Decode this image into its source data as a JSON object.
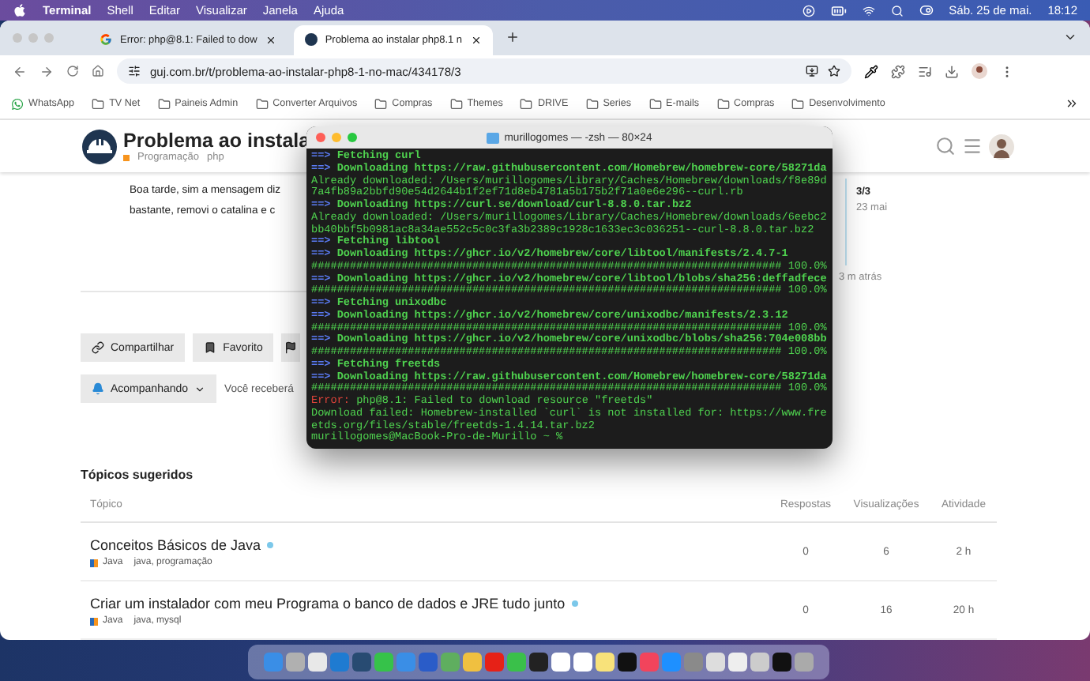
{
  "menu_bar": {
    "app": "Terminal",
    "menus": [
      "Shell",
      "Editar",
      "Visualizar",
      "Janela",
      "Ajuda"
    ],
    "date": "Sáb. 25 de mai.",
    "time": "18:12"
  },
  "browser": {
    "tabs": [
      {
        "title": "Error: php@8.1: Failed to dow",
        "kind": "google",
        "selected": false
      },
      {
        "title": "Problema ao instalar php8.1 n",
        "kind": "site",
        "selected": true
      }
    ],
    "address": "guj.com.br/t/problema-ao-instalar-php8-1-no-mac/434178/3",
    "bookmarks": [
      {
        "kind": "whatsapp",
        "label": "WhatsApp"
      },
      {
        "kind": "folder",
        "label": "TV Net"
      },
      {
        "kind": "folder",
        "label": "Paineis Admin"
      },
      {
        "kind": "folder",
        "label": "Converter Arquivos"
      },
      {
        "kind": "folder",
        "label": "Compras"
      },
      {
        "kind": "folder",
        "label": "Themes"
      },
      {
        "kind": "folder",
        "label": "DRIVE"
      },
      {
        "kind": "folder",
        "label": "Series"
      },
      {
        "kind": "folder",
        "label": "E-mails"
      },
      {
        "kind": "folder",
        "label": "Compras"
      },
      {
        "kind": "folder",
        "label": "Desenvolvimento"
      }
    ]
  },
  "page": {
    "title": "Problema ao instala",
    "category": "Programação",
    "tag": "php",
    "post_lines": [
      "Boa tarde, sim a mensagem diz",
      "bastante, removi o catalina e c"
    ],
    "timeline": {
      "position": "3/3",
      "date": "23 mai",
      "last": "3 m atrás"
    },
    "buttons": [
      {
        "kind": "share",
        "label": "Compartilhar"
      },
      {
        "kind": "bookmark",
        "label": "Favorito"
      },
      {
        "kind": "flag"
      }
    ],
    "follow": {
      "label": "Acompanhando",
      "note": "Você receberá"
    },
    "suggested": {
      "heading": "Tópicos sugeridos",
      "columns": [
        "Tópico",
        "Respostas",
        "Visualizações",
        "Atividade"
      ],
      "rows": [
        {
          "title": "Conceitos Básicos de Java",
          "unread": true,
          "category": "Java",
          "tags": "java, programação",
          "replies": "0",
          "views": "6",
          "activity": "2 h"
        },
        {
          "title": "Criar um instalador com meu Programa o banco de dados e JRE tudo junto",
          "unread": true,
          "category": "Java",
          "tags": "java, mysql",
          "replies": "0",
          "views": "16",
          "activity": "20 h"
        }
      ]
    }
  },
  "terminal": {
    "title": "murillogomes — -zsh — 80×24",
    "lines": [
      {
        "kind": "arrow",
        "prefix": "==>",
        "text": "Fetching curl"
      },
      {
        "kind": "arrow",
        "prefix": "==>",
        "text": "Downloading https://raw.githubusercontent.com/Homebrew/homebrew-core/58271da"
      },
      {
        "kind": "plain",
        "text": "Already downloaded: /Users/murillogomes/Library/Caches/Homebrew/downloads/f8e89d"
      },
      {
        "kind": "plain",
        "text": "7a4fb89a2bbfd90e54d2644b1f2ef71d8eb4781a5b175b2f71a0e6e296--curl.rb"
      },
      {
        "kind": "arrow",
        "prefix": "==>",
        "text": "Downloading https://curl.se/download/curl-8.8.0.tar.bz2"
      },
      {
        "kind": "plain",
        "text": "Already downloaded: /Users/murillogomes/Library/Caches/Homebrew/downloads/6eebc2"
      },
      {
        "kind": "plain",
        "text": "bb40bbf5b0981ac8a34ae552c5c0c3fa3b2389c1928c1633ec3c036251--curl-8.8.0.tar.bz2"
      },
      {
        "kind": "arrow",
        "prefix": "==>",
        "text": "Fetching libtool"
      },
      {
        "kind": "arrow",
        "prefix": "==>",
        "text": "Downloading https://ghcr.io/v2/homebrew/core/libtool/manifests/2.4.7-1"
      },
      {
        "kind": "plain",
        "text": "######################################################################### 100.0%"
      },
      {
        "kind": "arrow",
        "prefix": "==>",
        "text": "Downloading https://ghcr.io/v2/homebrew/core/libtool/blobs/sha256:deffadfece"
      },
      {
        "kind": "plain",
        "text": "######################################################################### 100.0%"
      },
      {
        "kind": "arrow",
        "prefix": "==>",
        "text": "Fetching unixodbc"
      },
      {
        "kind": "arrow",
        "prefix": "==>",
        "text": "Downloading https://ghcr.io/v2/homebrew/core/unixodbc/manifests/2.3.12"
      },
      {
        "kind": "plain",
        "text": "######################################################################### 100.0%"
      },
      {
        "kind": "arrow",
        "prefix": "==>",
        "text": "Downloading https://ghcr.io/v2/homebrew/core/unixodbc/blobs/sha256:704e008bb"
      },
      {
        "kind": "plain",
        "text": "######################################################################### 100.0%"
      },
      {
        "kind": "arrow",
        "prefix": "==>",
        "text": "Fetching freetds"
      },
      {
        "kind": "arrow",
        "prefix": "==>",
        "text": "Downloading https://raw.githubusercontent.com/Homebrew/homebrew-core/58271da"
      },
      {
        "kind": "plain",
        "text": "######################################################################### 100.0%"
      },
      {
        "kind": "error",
        "prefix": "Error:",
        "text": "php@8.1: Failed to download resource \"freetds\""
      },
      {
        "kind": "plain",
        "text": "Download failed: Homebrew-installed `curl` is not installed for: https://www.fre"
      },
      {
        "kind": "plain",
        "text": "etds.org/files/stable/freetds-1.4.14.tar.bz2"
      },
      {
        "kind": "plain",
        "text": "murillogomes@MacBook-Pro-de-Murillo ~ %"
      }
    ]
  }
}
